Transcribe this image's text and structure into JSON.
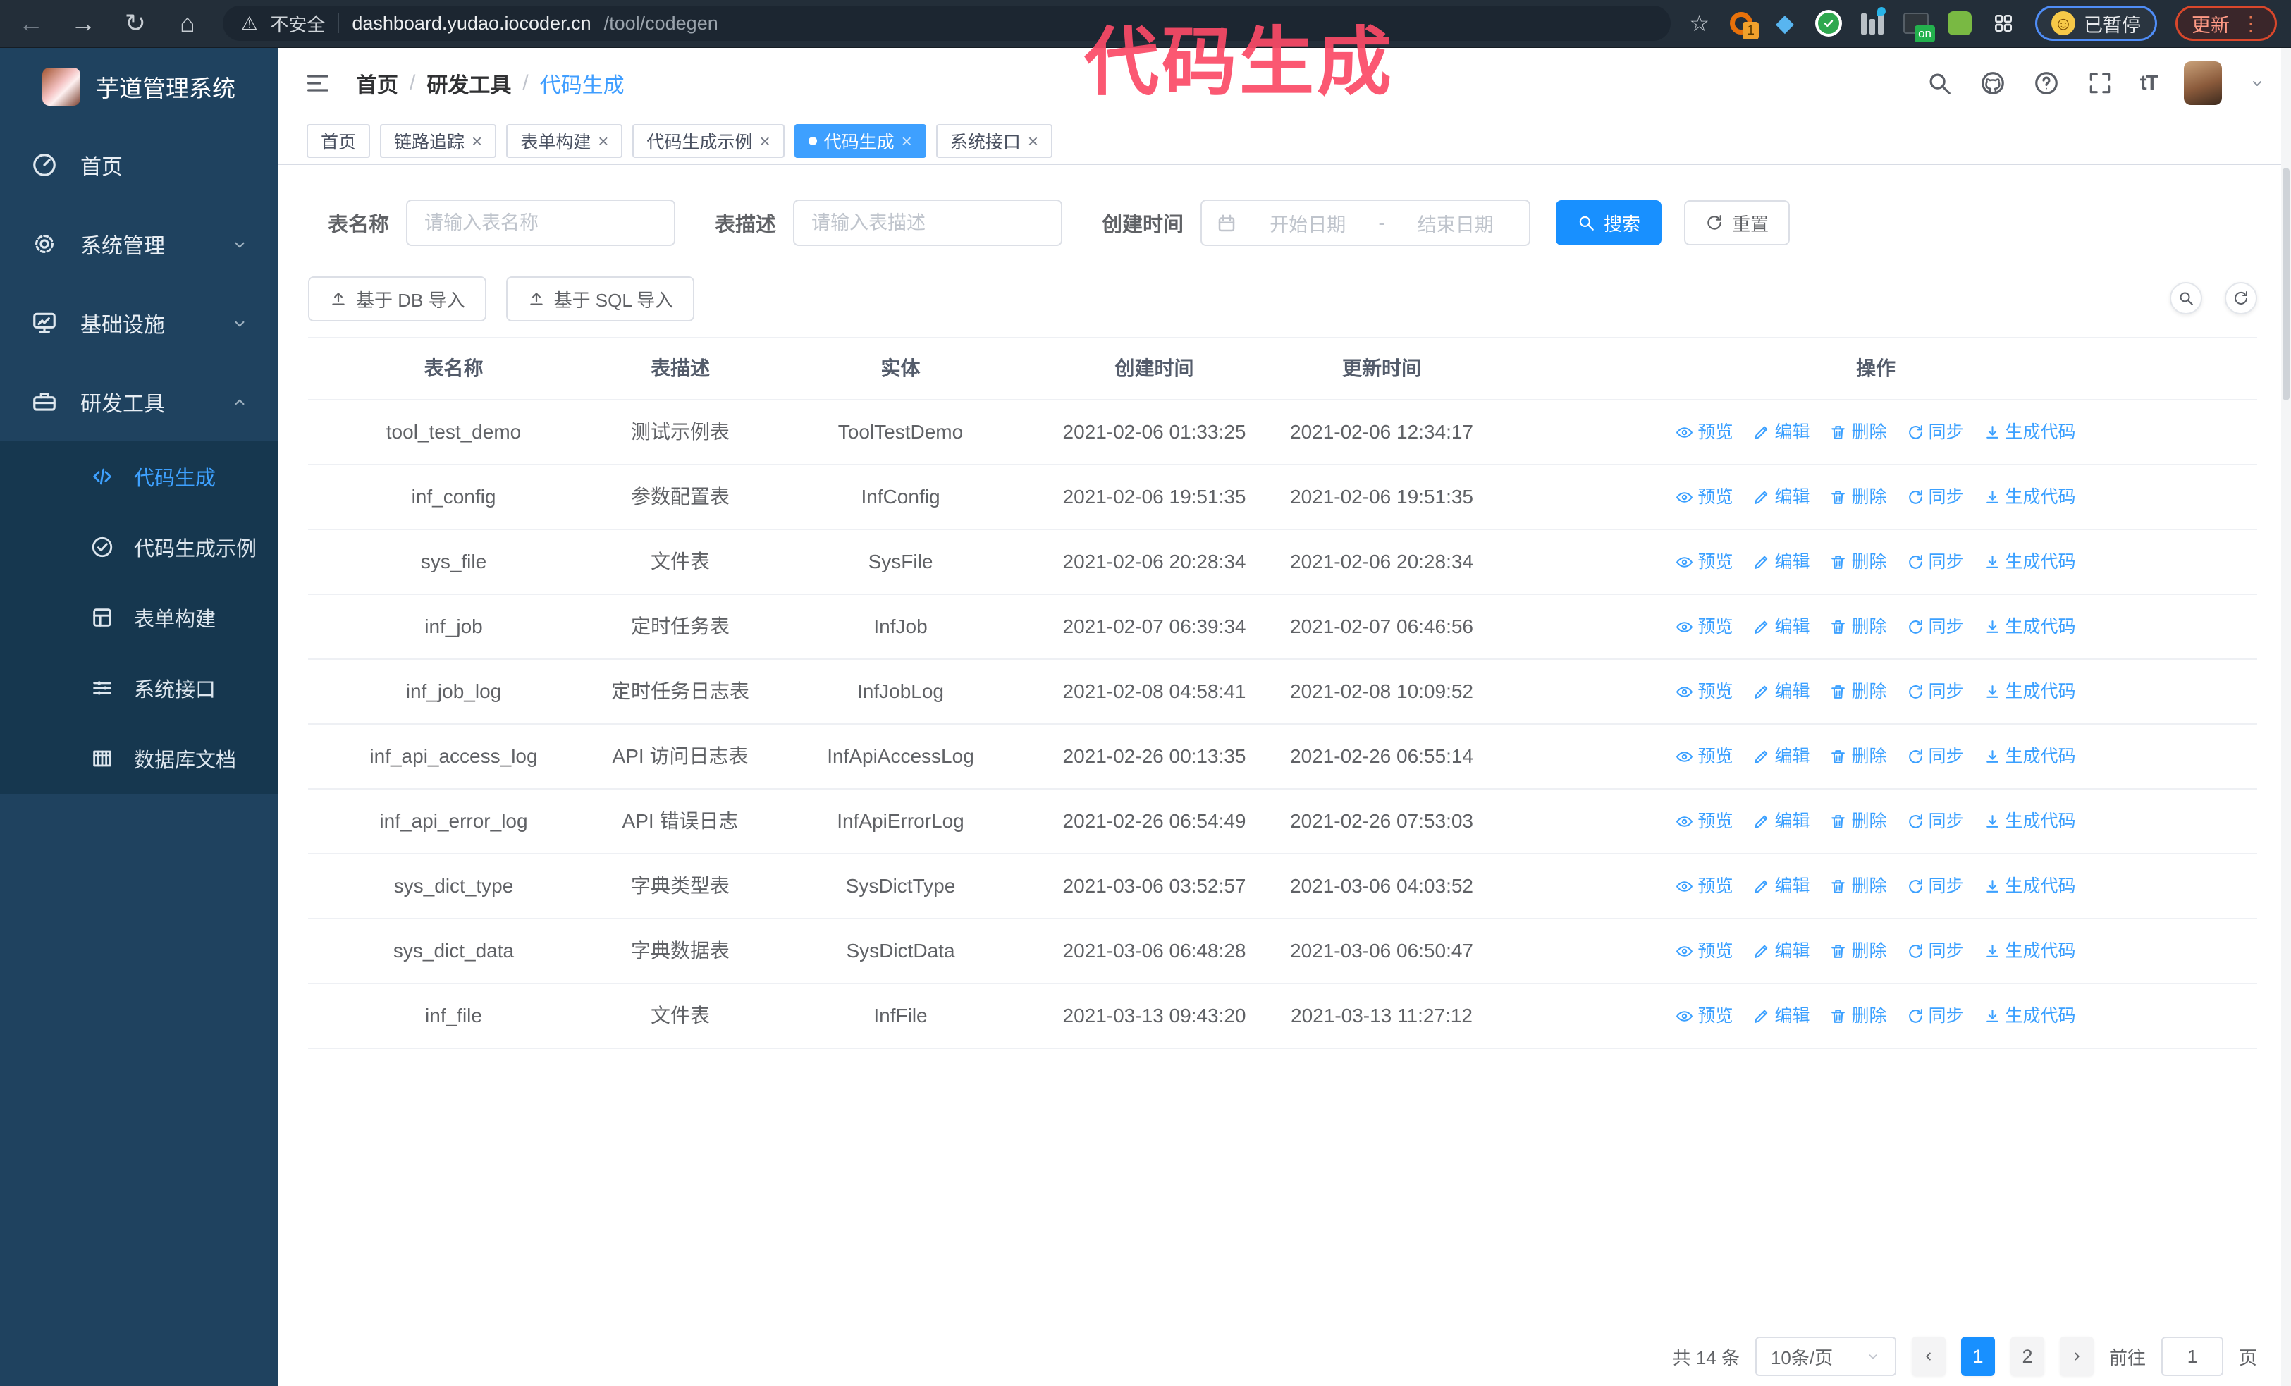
{
  "icons": {
    "back": "←",
    "forward": "→",
    "reload": "↻",
    "home": "⌂",
    "star": "☆",
    "warning": "⚠",
    "dots": "⋮",
    "close": "×",
    "smiley": "☺",
    "gem": "◆"
  },
  "colors": {
    "primary": "#1890ff",
    "link": "#3ba0ff",
    "sidebar_bg": "#1f425f",
    "submenu_bg": "#16374f",
    "tab_active": "#3ea0ff",
    "annotation": "#fb4a67"
  },
  "annotation": {
    "text": "代码生成"
  },
  "browser": {
    "security_label": "不安全",
    "url_domain": "dashboard.yudao.iocoder.cn",
    "url_path": "/tool/codegen",
    "ext_badge": "1",
    "ext_on_badge": "on",
    "paused_label": "已暂停",
    "update_label": "更新"
  },
  "sidebar": {
    "logo_title": "芋道管理系统",
    "items": [
      {
        "label": "首页",
        "icon": "gauge"
      },
      {
        "label": "系统管理",
        "icon": "gear",
        "chevron": "down"
      },
      {
        "label": "基础设施",
        "icon": "monitor",
        "chevron": "down"
      },
      {
        "label": "研发工具",
        "icon": "toolbox",
        "chevron": "up",
        "active": false
      }
    ],
    "submenu": [
      {
        "label": "代码生成",
        "icon": "code",
        "active": true
      },
      {
        "label": "代码生成示例",
        "icon": "check"
      },
      {
        "label": "表单构建",
        "icon": "grid"
      },
      {
        "label": "系统接口",
        "icon": "sliders"
      },
      {
        "label": "数据库文档",
        "icon": "columns"
      }
    ]
  },
  "header": {
    "separator": "/",
    "breadcrumb": [
      {
        "label": "首页",
        "sep": false
      },
      {
        "label": "研发工具",
        "sep": true
      },
      {
        "label": "代码生成",
        "sep": true,
        "active": true
      }
    ]
  },
  "tabs": [
    {
      "label": "首页",
      "closable": false
    },
    {
      "label": "链路追踪",
      "closable": true
    },
    {
      "label": "表单构建",
      "closable": true
    },
    {
      "label": "代码生成示例",
      "closable": true
    },
    {
      "label": "代码生成",
      "closable": true,
      "active": true
    },
    {
      "label": "系统接口",
      "closable": true
    }
  ],
  "filters": {
    "table_name_label": "表名称",
    "table_name_placeholder": "请输入表名称",
    "table_desc_label": "表描述",
    "table_desc_placeholder": "请输入表描述",
    "create_time_label": "创建时间",
    "date_start_placeholder": "开始日期",
    "date_separator": "-",
    "date_end_placeholder": "结束日期",
    "search_label": "搜索",
    "reset_label": "重置"
  },
  "toolbar": {
    "import_db_label": "基于 DB 导入",
    "import_sql_label": "基于 SQL 导入"
  },
  "table": {
    "columns": [
      "表名称",
      "表描述",
      "实体",
      "创建时间",
      "更新时间",
      "操作"
    ],
    "actions": [
      {
        "label": "预览",
        "icon": "eye"
      },
      {
        "label": "编辑",
        "icon": "pencil"
      },
      {
        "label": "删除",
        "icon": "trash"
      },
      {
        "label": "同步",
        "icon": "sync"
      },
      {
        "label": "生成代码",
        "icon": "download"
      }
    ],
    "rows": [
      {
        "name": "tool_test_demo",
        "desc": "测试示例表",
        "entity": "ToolTestDemo",
        "created": "2021-02-06 01:33:25",
        "updated": "2021-02-06 12:34:17"
      },
      {
        "name": "inf_config",
        "desc": "参数配置表",
        "entity": "InfConfig",
        "created": "2021-02-06 19:51:35",
        "updated": "2021-02-06 19:51:35"
      },
      {
        "name": "sys_file",
        "desc": "文件表",
        "entity": "SysFile",
        "created": "2021-02-06 20:28:34",
        "updated": "2021-02-06 20:28:34"
      },
      {
        "name": "inf_job",
        "desc": "定时任务表",
        "entity": "InfJob",
        "created": "2021-02-07 06:39:34",
        "updated": "2021-02-07 06:46:56"
      },
      {
        "name": "inf_job_log",
        "desc": "定时任务日志表",
        "entity": "InfJobLog",
        "created": "2021-02-08 04:58:41",
        "updated": "2021-02-08 10:09:52"
      },
      {
        "name": "inf_api_access_log",
        "desc": "API 访问日志表",
        "entity": "InfApiAccessLog",
        "created": "2021-02-26 00:13:35",
        "updated": "2021-02-26 06:55:14"
      },
      {
        "name": "inf_api_error_log",
        "desc": "API 错误日志",
        "entity": "InfApiErrorLog",
        "created": "2021-02-26 06:54:49",
        "updated": "2021-02-26 07:53:03"
      },
      {
        "name": "sys_dict_type",
        "desc": "字典类型表",
        "entity": "SysDictType",
        "created": "2021-03-06 03:52:57",
        "updated": "2021-03-06 04:03:52"
      },
      {
        "name": "sys_dict_data",
        "desc": "字典数据表",
        "entity": "SysDictData",
        "created": "2021-03-06 06:48:28",
        "updated": "2021-03-06 06:50:47"
      },
      {
        "name": "inf_file",
        "desc": "文件表",
        "entity": "InfFile",
        "created": "2021-03-13 09:43:20",
        "updated": "2021-03-13 11:27:12"
      }
    ]
  },
  "pagination": {
    "total_label": "共 14 条",
    "page_size_label": "10条/页",
    "pages": [
      {
        "label": "1",
        "active": true
      },
      {
        "label": "2"
      }
    ],
    "goto_label": "前往",
    "goto_value": "1",
    "page_unit_label": "页"
  }
}
